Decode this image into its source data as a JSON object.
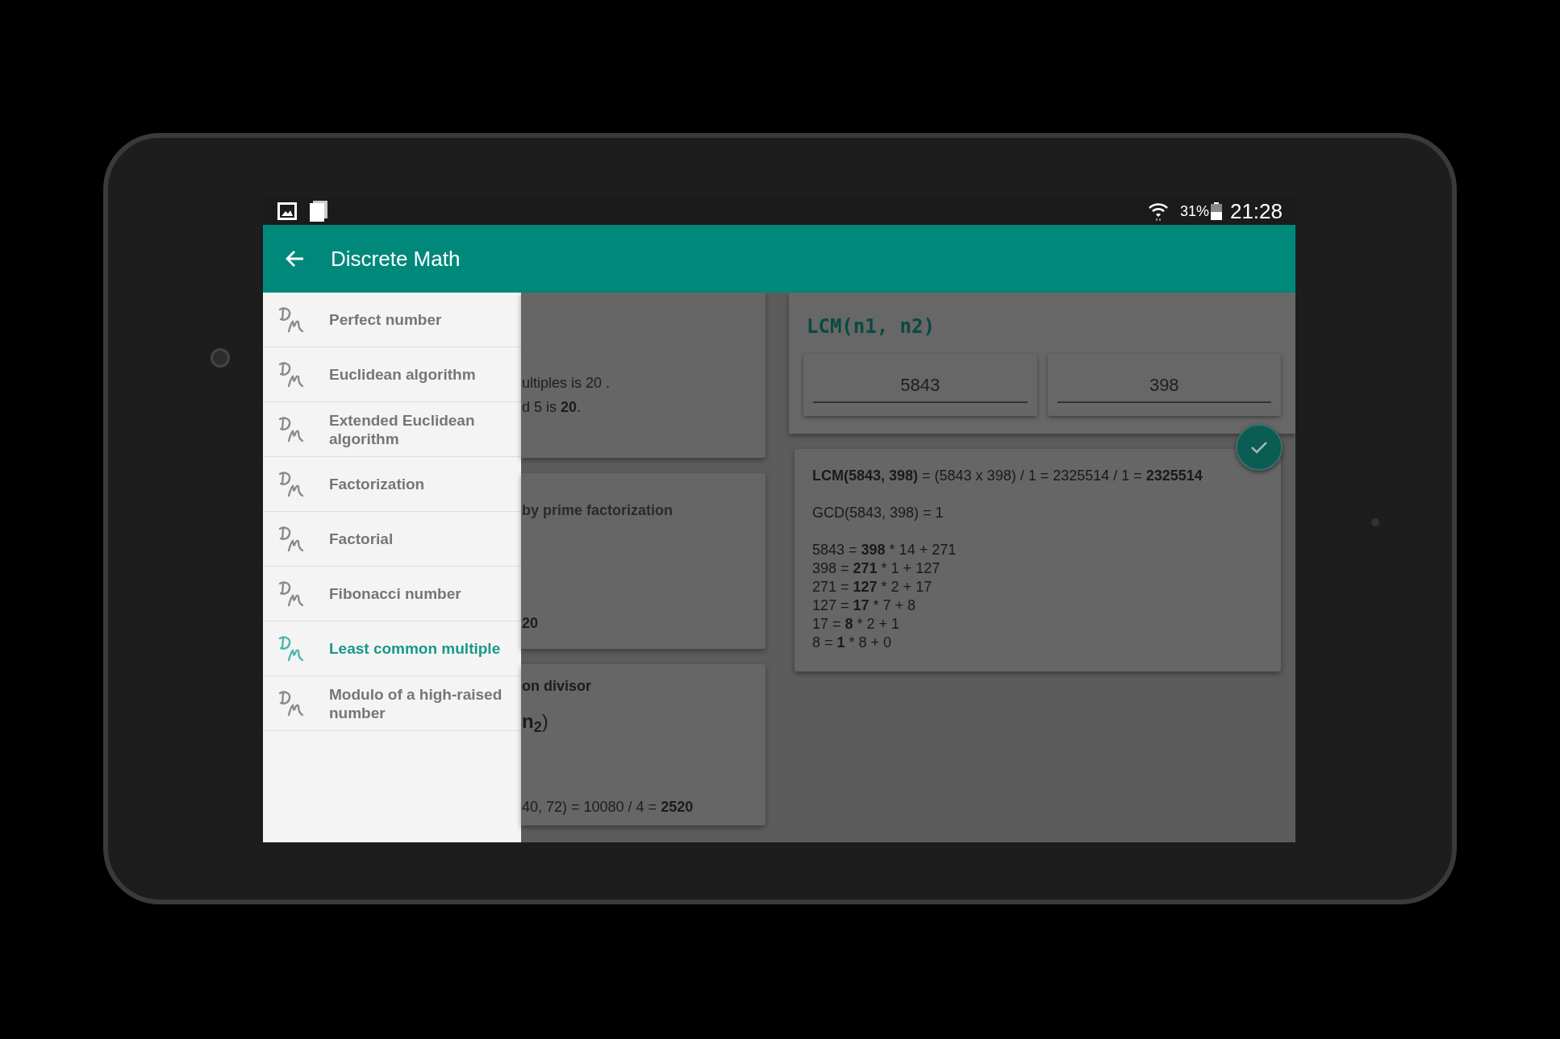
{
  "status_bar": {
    "battery": "31%",
    "time": "21:28"
  },
  "toolbar": {
    "title": "Discrete Math"
  },
  "drawer": {
    "items": [
      {
        "label": "Perfect number",
        "selected": false
      },
      {
        "label": "Euclidean algorithm",
        "selected": false
      },
      {
        "label": "Extended Euclidean algorithm",
        "selected": false
      },
      {
        "label": "Factorization",
        "selected": false
      },
      {
        "label": "Factorial",
        "selected": false
      },
      {
        "label": "Fibonacci number",
        "selected": false
      },
      {
        "label": "Least common multiple",
        "selected": true
      },
      {
        "label": "Modulo of a high-raised number",
        "selected": false
      }
    ]
  },
  "background_cards": [
    {
      "lines": [
        "ultiples is 20 .",
        "d 5 is **20**."
      ]
    },
    {
      "lines": [
        "by prime factorization",
        "**20**"
      ]
    },
    {
      "lines": [
        "on divisor",
        "**n$_{2}$**)",
        "40, 72) = 10080 / 4 = **2520**"
      ]
    }
  ],
  "calculator": {
    "title": "LCM(n1, n2)",
    "inputs": [
      "5843",
      "398"
    ]
  },
  "result": {
    "summary": "**LCM(5843, 398)** = (5843 x 398) / 1 = 2325514 / 1 = **2325514**",
    "gcd": "GCD(5843, 398) = 1",
    "steps": [
      "5843 = **398** * 14 + 271",
      "398 = **271** * 1 + 127",
      "271 = **127** * 2 + 17",
      "127 = **17** * 7 + 8",
      "17 = **8** * 2 + 1",
      "8 = **1** * 8 + 0"
    ]
  }
}
